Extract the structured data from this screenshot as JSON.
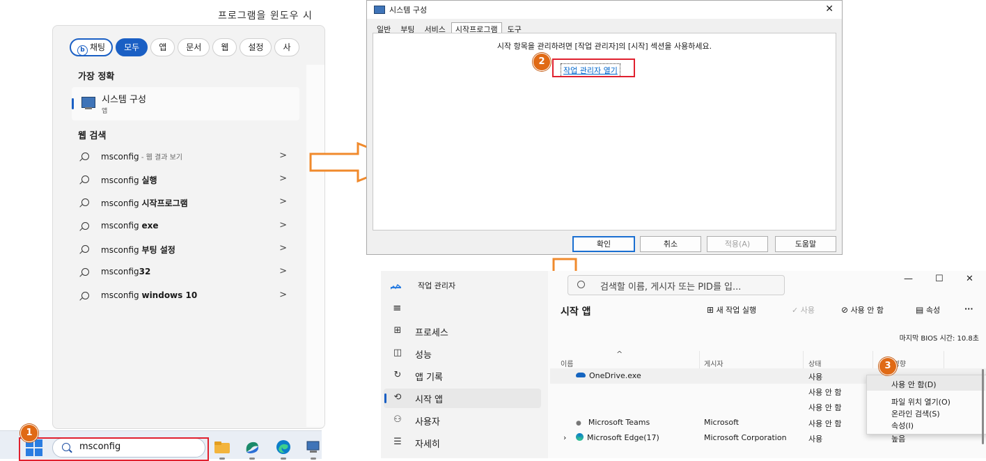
{
  "caption": "프로그램을 윈도우 시",
  "search": {
    "filters": [
      {
        "label": "채팅",
        "state": "chat"
      },
      {
        "label": "모두",
        "state": "active"
      },
      {
        "label": "앱"
      },
      {
        "label": "문서"
      },
      {
        "label": "웹"
      },
      {
        "label": "설정"
      },
      {
        "label": "사"
      }
    ],
    "best_match_heading": "가장 정확",
    "best_match": {
      "title": "시스템 구성",
      "subtitle": "앱"
    },
    "web_heading": "웹 검색",
    "web_results": [
      {
        "prefix": "msconfig",
        "bold": "",
        "suffix": " - 웹 결과 보기"
      },
      {
        "prefix": "msconfig ",
        "bold": "실행",
        "suffix": ""
      },
      {
        "prefix": "msconfig ",
        "bold": "시작프로그램",
        "suffix": ""
      },
      {
        "prefix": "msconfig ",
        "bold": "exe",
        "suffix": ""
      },
      {
        "prefix": "msconfig ",
        "bold": "부팅 설정",
        "suffix": ""
      },
      {
        "prefix": "msconfig",
        "bold": "32",
        "suffix": ""
      },
      {
        "prefix": "msconfig ",
        "bold": "windows 10",
        "suffix": ""
      }
    ],
    "chevron": ">"
  },
  "taskbar": {
    "search_value": "msconfig"
  },
  "badges": [
    "1",
    "2",
    "3"
  ],
  "msconfig": {
    "title": "시스템 구성",
    "close": "✕",
    "tabs": [
      "일반",
      "부팅",
      "서비스",
      "시작프로그램",
      "도구"
    ],
    "selected_tab": 3,
    "message": "시작 항목을 관리하려면 [작업 관리자]의 [시작] 섹션을 사용하세요.",
    "link": "작업 관리자 열기",
    "buttons": [
      "확인",
      "취소",
      "적용(A)",
      "도움말"
    ]
  },
  "taskmgr": {
    "title": "작업 관리자",
    "search_placeholder": "검색할 이름, 게시자 또는 PID를 입...",
    "window_controls": [
      "—",
      "☐",
      "✕"
    ],
    "menu_icon": "≡",
    "nav": [
      {
        "icon": "⊞",
        "label": "프로세스"
      },
      {
        "icon": "◫",
        "label": "성능"
      },
      {
        "icon": "↻",
        "label": "앱 기록"
      },
      {
        "icon": "⟲",
        "label": "시작 앱"
      },
      {
        "icon": "⚇",
        "label": "사용자"
      },
      {
        "icon": "☰",
        "label": "자세히"
      }
    ],
    "heading": "시작 앱",
    "actions": {
      "new_task": "새 작업 실행",
      "enable": "사용",
      "disable": "사용 안 함",
      "properties": "속성",
      "more": "···"
    },
    "bios_time": "마지막 BIOS 시간:  10.8초",
    "columns": {
      "name": "이름",
      "publisher": "게시자",
      "status": "상태",
      "impact": "시작 영향"
    },
    "sort_indicator": "^",
    "rows": [
      {
        "name": "OneDrive.exe",
        "publisher": "",
        "status": "사용",
        "impact": ""
      },
      {
        "name": "",
        "publisher": "",
        "status": "사용 안 함",
        "impact": ""
      },
      {
        "name": "",
        "publisher": "",
        "status": "사용 안 함",
        "impact": ""
      },
      {
        "name": "Microsoft Teams",
        "publisher": "Microsoft",
        "status": "사용 안 함",
        "impact": ""
      },
      {
        "name": "Microsoft Edge(17)",
        "publisher": "Microsoft Corporation",
        "status": "사용",
        "impact": "높음"
      }
    ],
    "context_menu": [
      "사용 안 함(D)",
      "파일 위치 열기(O)",
      "온라인 검색(S)",
      "속성(I)"
    ]
  },
  "colors": {
    "accent": "#1a5fc4",
    "annotation_red": "#e0202e",
    "badge_orange": "#e06a15",
    "arrow_orange": "#f08a2c"
  }
}
